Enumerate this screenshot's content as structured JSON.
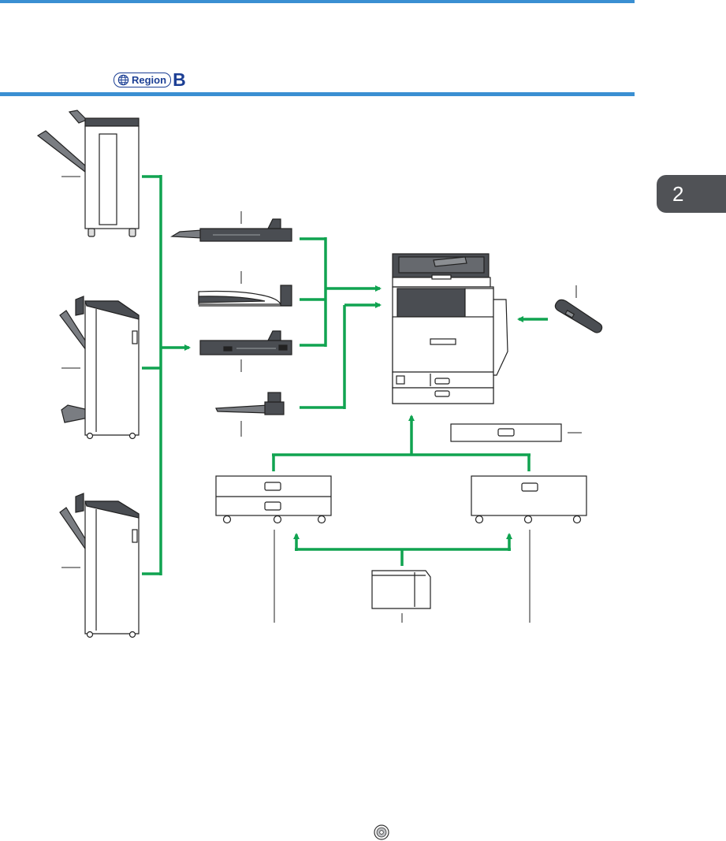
{
  "header": {
    "region_label": "Region",
    "region_letter": "B"
  },
  "chapter_tab": {
    "label": "2"
  },
  "colors": {
    "rule": "#3a8fd2",
    "arrow": "#10a350",
    "region": "#1c3f94",
    "tab": "#505256",
    "device_dark": "#4a4d52",
    "outline": "#222222"
  },
  "icons": {
    "region": "globe-icon",
    "footer": "disc-icon"
  }
}
